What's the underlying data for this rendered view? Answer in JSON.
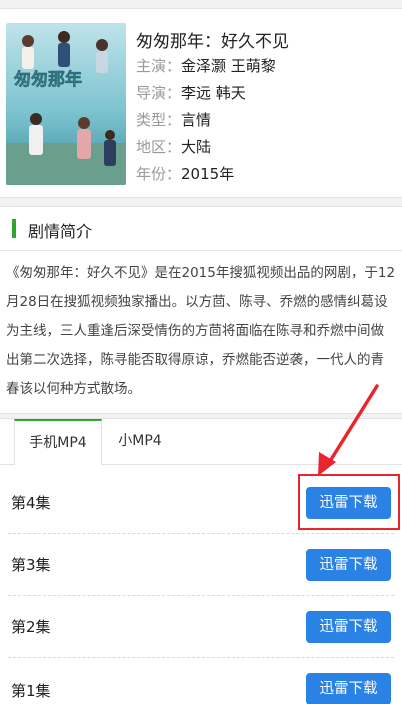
{
  "show": {
    "title": "匆匆那年：好久不见",
    "meta": [
      {
        "key": "主演：",
        "value": "金泽灏 王萌黎"
      },
      {
        "key": "导演：",
        "value": "李远 韩天"
      },
      {
        "key": "类型：",
        "value": "言情"
      },
      {
        "key": "地区：",
        "value": "大陆"
      },
      {
        "key": "年份：",
        "value": "2015年"
      }
    ],
    "poster_text": "匆匆那年"
  },
  "synopsis": {
    "heading": "剧情简介",
    "text": "《匆匆那年：好久不见》是在2015年搜狐视频出品的网剧，于12月28日在搜狐视频独家播出。以方茴、陈寻、乔燃的感情纠葛设为主线，三人重逢后深受情伤的方茴将面临在陈寻和乔燃中间做出第二次选择，陈寻能否取得原谅，乔燃能否逆袭，一代人的青春该以何种方式散场。"
  },
  "tabs": {
    "active": "手机MP4",
    "inactive": "小MP4"
  },
  "episodes": [
    {
      "label": "第4集",
      "button": "迅雷下载"
    },
    {
      "label": "第3集",
      "button": "迅雷下载"
    },
    {
      "label": "第2集",
      "button": "迅雷下载"
    },
    {
      "label": "第1集",
      "button": "迅雷下载"
    }
  ],
  "colors": {
    "accent_green": "#2ea52e",
    "button_blue": "#2a82e4",
    "annotation_red": "#e8262b"
  }
}
